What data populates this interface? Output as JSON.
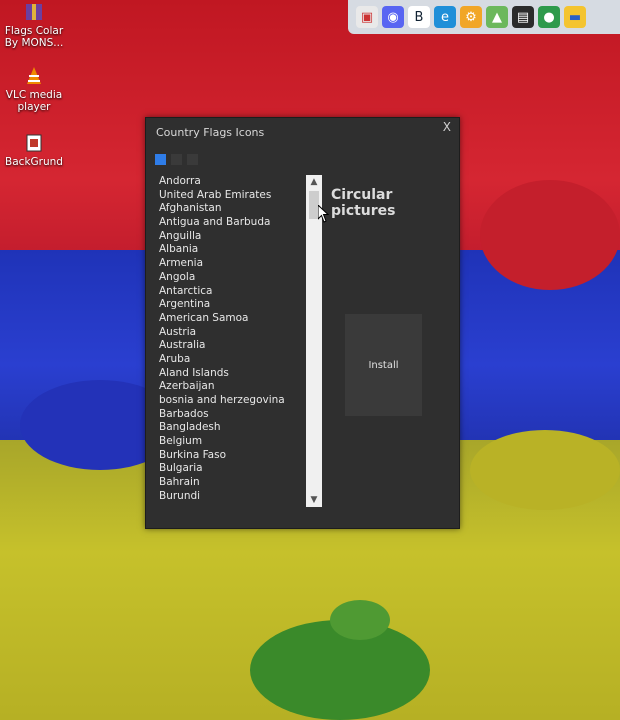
{
  "desktop": {
    "icons": [
      {
        "label": "Flags Colar By MONS...",
        "icon": "archive-icon"
      },
      {
        "label": "VLC media player",
        "icon": "vlc-cone-icon"
      },
      {
        "label": "BackGrund",
        "icon": "app-icon"
      }
    ]
  },
  "taskbar": {
    "icons": [
      "slideshow-icon",
      "discord-icon",
      "stylized-b-icon",
      "edge-icon",
      "gear-icon",
      "photos-icon",
      "terminal-icon",
      "globe-icon",
      "folder-icon"
    ]
  },
  "window": {
    "title": "Country Flags Icons",
    "close_label": "X",
    "pages": 3,
    "active_page": 1,
    "heading": "Circular pictures",
    "install_label": "Install",
    "countries": [
      "Andorra",
      "United Arab Emirates",
      "Afghanistan",
      "Antigua and Barbuda",
      "Anguilla",
      "Albania",
      "Armenia",
      "Angola",
      "Antarctica",
      "Argentina",
      "American Samoa",
      "Austria",
      "Australia",
      "Aruba",
      "Aland Islands",
      "Azerbaijan",
      "bosnia and herzegovina",
      "Barbados",
      "Bangladesh",
      "Belgium",
      "Burkina Faso",
      "Bulgaria",
      "Bahrain",
      "Burundi"
    ]
  },
  "colors": {
    "accent": "#2f7de8",
    "window_bg": "#2f2f2f",
    "wallpaper_red": "#c81e2b",
    "wallpaper_blue": "#2a3fd0",
    "wallpaper_yellow": "#c6c12b"
  }
}
